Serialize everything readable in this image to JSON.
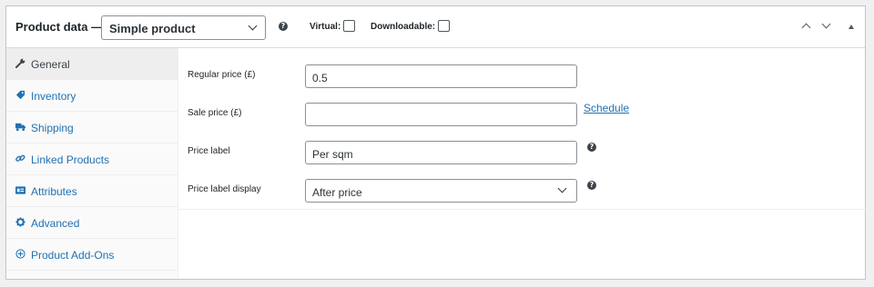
{
  "header": {
    "title": "Product data —",
    "product_type": "Simple product",
    "help_icon": "?",
    "virtual_label": "Virtual:",
    "downloadable_label": "Downloadable:",
    "virtual_checked": false,
    "downloadable_checked": false
  },
  "sidebar": {
    "tabs": [
      {
        "label": "General",
        "icon": "wrench-icon",
        "active": true
      },
      {
        "label": "Inventory",
        "icon": "tag-icon",
        "active": false
      },
      {
        "label": "Shipping",
        "icon": "truck-icon",
        "active": false
      },
      {
        "label": "Linked Products",
        "icon": "link-icon",
        "active": false
      },
      {
        "label": "Attributes",
        "icon": "list-card-icon",
        "active": false
      },
      {
        "label": "Advanced",
        "icon": "gear-icon",
        "active": false
      },
      {
        "label": "Product Add-Ons",
        "icon": "plus-circle-icon",
        "active": false
      }
    ]
  },
  "fields": {
    "regular_price": {
      "label": "Regular price (£)",
      "value": "0.5"
    },
    "sale_price": {
      "label": "Sale price (£)",
      "value": "",
      "schedule_link": "Schedule"
    },
    "price_label": {
      "label": "Price label",
      "value": "Per sqm"
    },
    "price_label_display": {
      "label": "Price label display",
      "value": "After price"
    }
  },
  "colors": {
    "link": "#2271b1",
    "border": "#8c8f94",
    "sidebar_bg": "#fafafa",
    "active_tab_bg": "#eeeeee"
  }
}
